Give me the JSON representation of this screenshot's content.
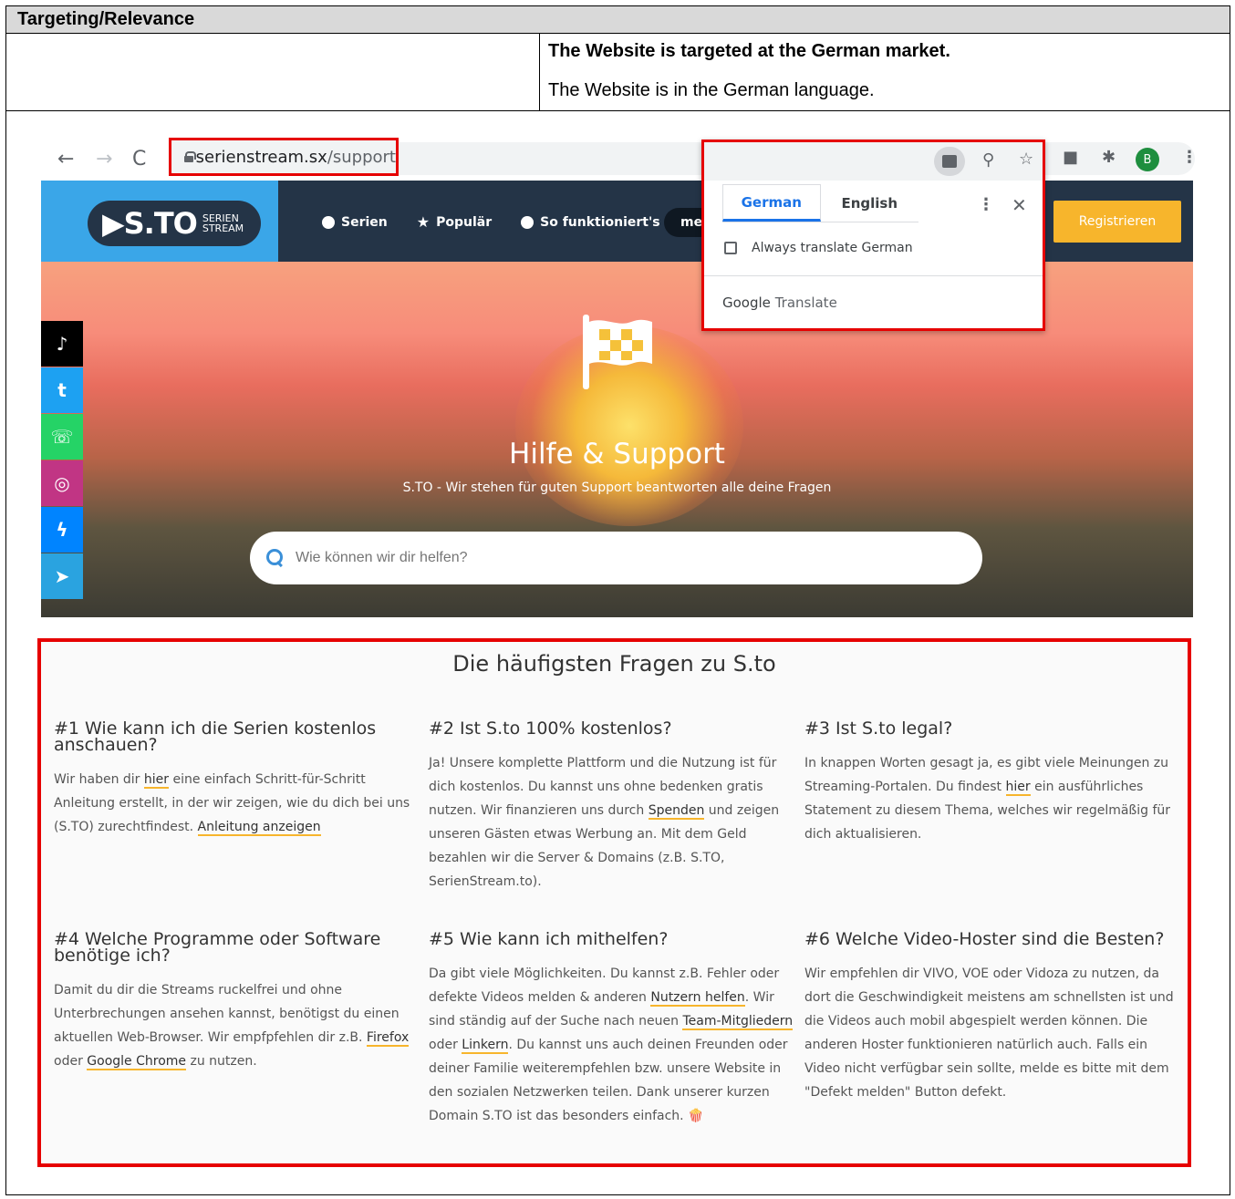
{
  "doc": {
    "header": "Targeting/Relevance",
    "statement_bold": "The Website is targeted at the German market.",
    "statement": "The Website is in the German language."
  },
  "browser": {
    "url_domain": "serienstream.sx",
    "url_path": "/support",
    "avatar_letter": "B"
  },
  "translate_popup": {
    "tabs": [
      "German",
      "English"
    ],
    "checkbox_label": "Always translate German",
    "footer_google": "Google",
    "footer_translate": "Translate"
  },
  "site": {
    "logo_main": "▶S.TO",
    "logo_sub_1": "SERIEN",
    "logo_sub_2": "STREAM",
    "nav": [
      "Serien",
      "Populär",
      "So funktioniert's"
    ],
    "nav_pill": "me",
    "register": "Registrieren"
  },
  "social": [
    "tiktok-icon",
    "twitter-icon",
    "whatsapp-icon",
    "instagram-icon",
    "messenger-icon",
    "telegram-icon"
  ],
  "hero": {
    "title": "Hilfe & Support",
    "subtitle": "S.TO - Wir stehen für guten Support beantworten alle deine Fragen",
    "search_placeholder": "Wie können wir dir helfen?"
  },
  "faq": {
    "title": "Die häufigsten Fragen zu S.to",
    "items": [
      {
        "q": "#1 Wie kann ich die Serien kostenlos anschauen?",
        "a_parts": [
          "Wir haben dir ",
          "hier",
          " eine einfach Schritt-für-Schritt Anleitung erstellt, in der wir zeigen, wie du dich bei uns (S.TO) zurechtfindest. ",
          "Anleitung anzeigen",
          ""
        ]
      },
      {
        "q": "#2 Ist S.to 100% kostenlos?",
        "a_parts": [
          "Ja! Unsere komplette Plattform und die Nutzung ist für dich kostenlos. Du kannst uns ohne bedenken gratis nutzen. Wir finanzieren uns durch ",
          "Spenden",
          " und zeigen unseren Gästen etwas Werbung an. Mit dem Geld bezahlen wir die Server & Domains (z.B. S.TO, SerienStream.to).",
          "",
          ""
        ]
      },
      {
        "q": "#3 Ist S.to legal?",
        "a_parts": [
          "In knappen Worten gesagt ja, es gibt viele Meinungen zu Streaming-Portalen. Du findest ",
          "hier",
          " ein ausführliches Statement zu diesem Thema, welches wir regelmäßig für dich aktualisieren.",
          "",
          ""
        ]
      },
      {
        "q": "#4 Welche Programme oder Software benötige ich?",
        "a_parts": [
          "Damit du dir die Streams ruckelfrei und ohne Unterbrechungen ansehen kannst, benötigst du einen aktuellen Web-Browser. Wir empfpfehlen dir z.B. ",
          "Firefox",
          " oder ",
          "Google Chrome",
          " zu nutzen."
        ]
      },
      {
        "q": "#5 Wie kann ich mithelfen?",
        "a_parts": [
          "Da gibt viele Möglichkeiten. Du kannst z.B. Fehler oder defekte Videos melden & anderen ",
          "Nutzern helfen",
          ". Wir sind ständig auf der Suche nach neuen ",
          "Team-Mitgliedern",
          " oder ",
          "Linkern",
          ". Du kannst uns auch deinen Freunden oder deiner Familie weiterempfehlen bzw. unsere Website in den sozialen Netzwerken teilen. Dank unserer kurzen Domain S.TO ist das besonders einfach. 🍿"
        ]
      },
      {
        "q": "#6 Welche Video-Hoster sind die Besten?",
        "a_parts": [
          "Wir empfehlen dir VIVO, VOE oder Vidoza zu nutzen, da dort die Geschwindigkeit meistens am schnellsten ist und die Videos auch mobil abgespielt werden können. Die anderen Hoster funktionieren natürlich auch. Falls ein Video nicht verfügbar sein sollte, melde es bitte mit dem \"Defekt melden\" Button defekt.",
          "",
          "",
          "",
          ""
        ]
      }
    ]
  }
}
